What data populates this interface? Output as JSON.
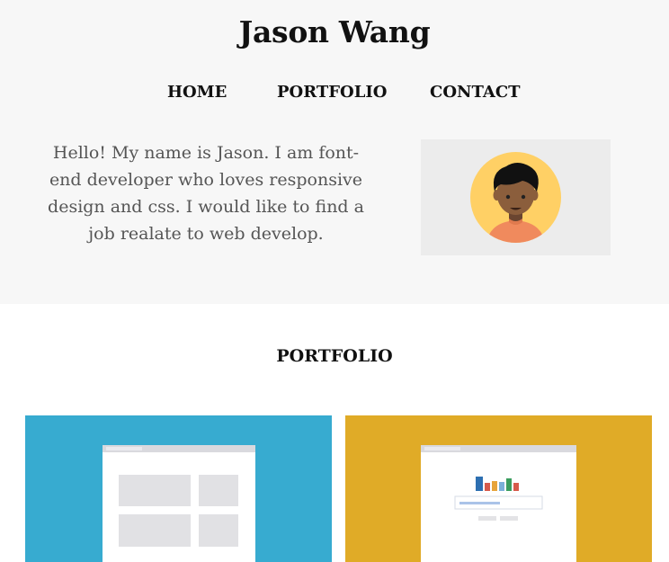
{
  "header": {
    "title": "Jason Wang",
    "nav": {
      "home": "HOME",
      "portfolio": "PORTFOLIO",
      "contact": "CONTACT"
    },
    "intro": "Hello! My name is Jason. I am font-end developer who loves responsive design and css. I would like to find a job realate to web develop."
  },
  "portfolio": {
    "title": "PORTFOLIO",
    "cards": [
      {
        "color": "#37abd0",
        "icon": "wireframe-layout-icon"
      },
      {
        "color": "#e0ab27",
        "icon": "bar-chart-dashboard-icon"
      }
    ]
  },
  "colors": {
    "hero_background": "#f7f7f7",
    "avatar_background": "#ffd065",
    "card_blue": "#37abd0",
    "card_gold": "#e0ab27"
  }
}
